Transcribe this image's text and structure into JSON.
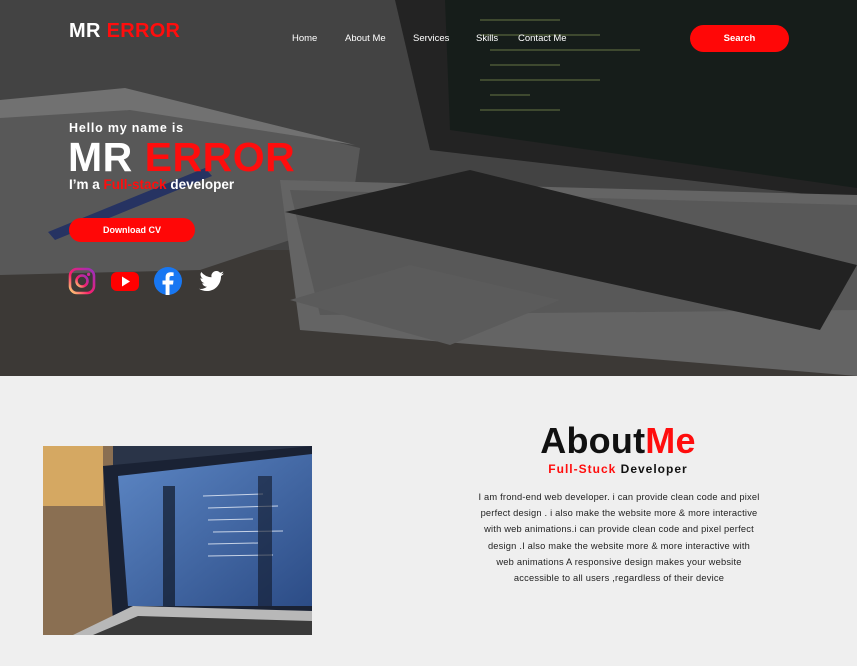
{
  "header": {
    "logo_part1": "MR",
    "logo_part2": "ERROR",
    "nav": [
      "Home",
      "About Me",
      "Services",
      "Skills",
      "Contact Me"
    ],
    "search_label": "Search"
  },
  "hero": {
    "greeting": "Hello my name is",
    "name_part1": "MR",
    "name_part2": "ERROR",
    "tagline_prefix": "I’m a",
    "tagline_highlight": "Full-stack",
    "tagline_suffix": "developer",
    "download_label": "Download CV",
    "socials": [
      "instagram-icon",
      "youtube-icon",
      "facebook-icon",
      "twitter-icon"
    ]
  },
  "about": {
    "title_part1": "About",
    "title_part2": "Me",
    "subtitle_highlight": "Full-Stuck",
    "subtitle_rest": "Developer",
    "body": "I am frond-end web developer. i can provide clean code and pixel perfect design . i also make the website more & more interactive with web animations.i can provide clean code and pixel perfect design .I also make the website more & more interactive with web animations A responsive design makes your website accessible to all users ,regardless of their device"
  },
  "colors": {
    "accent": "#ff0707",
    "hero_overlay": "#4f4f4f",
    "section_bg": "#efefef"
  }
}
